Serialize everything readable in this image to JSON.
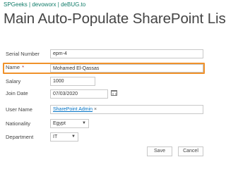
{
  "site_links": "SPGeeks | devoworx | deBUG.to",
  "page_title": "Main Auto-Populate SharePoint List",
  "form": {
    "serial_number": {
      "label": "Serial Number",
      "value": "epm-4"
    },
    "name": {
      "label": "Name",
      "required_marker": "*",
      "value": "Mohamed El-Qassas"
    },
    "salary": {
      "label": "Salary",
      "value": "1000"
    },
    "join_date": {
      "label": "Join Date",
      "value": "07/03/2020",
      "icon": "calendar-icon"
    },
    "user_name": {
      "label": "User Name",
      "value": "SharePoint Admin",
      "remove_glyph": "×"
    },
    "nationality": {
      "label": "Nationality",
      "value": "Egypt",
      "icon": "chevron-down-icon"
    },
    "department": {
      "label": "Department",
      "value": "IT",
      "icon": "chevron-down-icon"
    }
  },
  "buttons": {
    "save": "Save",
    "cancel": "Cancel"
  },
  "colors": {
    "link": "#0f7b68",
    "highlight": "#f0922b",
    "required": "#a4262c",
    "people_link": "#0072c6"
  }
}
